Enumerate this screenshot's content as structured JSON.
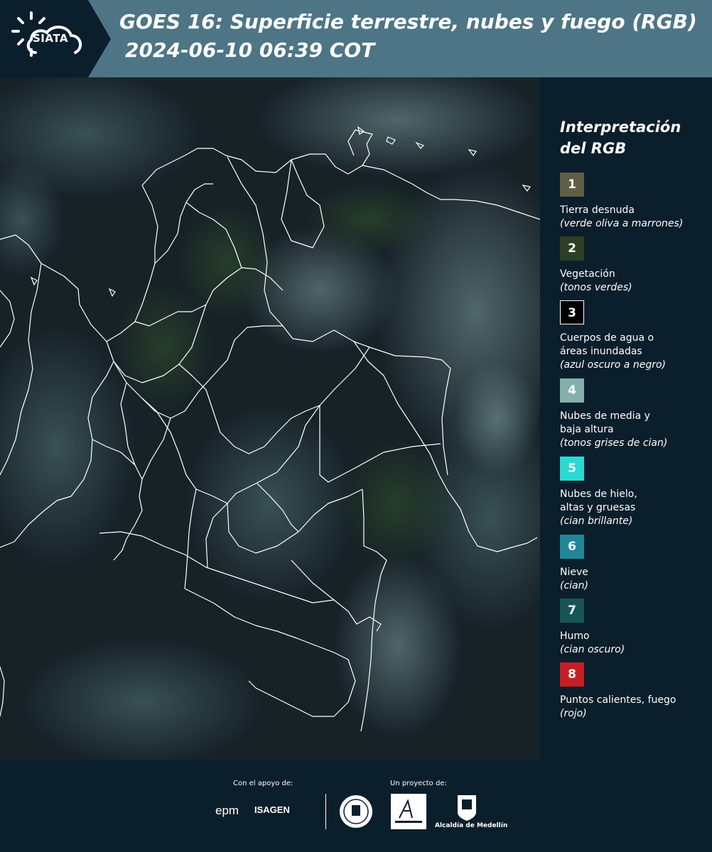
{
  "header": {
    "logo_text": "SIATA",
    "title_line1": "GOES 16: Superficie terrestre, nubes y fuego (RGB)",
    "title_line2": "2024-06-10 06:39 COT"
  },
  "legend": {
    "title_line1": "Interpretación",
    "title_line2": "del RGB",
    "items": [
      {
        "number": "1",
        "color": "#5f5e46",
        "label_lines": [
          "Tierra desnuda"
        ],
        "sub": "(verde oliva a marrones)"
      },
      {
        "number": "2",
        "color": "#2d4024",
        "label_lines": [
          "Vegetación"
        ],
        "sub": "(tonos verdes)"
      },
      {
        "number": "3",
        "color": "#000000",
        "label_lines": [
          "Cuerpos de agua o",
          "áreas inundadas"
        ],
        "sub": "(azul oscuro a negro)"
      },
      {
        "number": "4",
        "color": "#86aeab",
        "label_lines": [
          "Nubes de media y",
          "baja altura"
        ],
        "sub": "(tonos grises de cian)"
      },
      {
        "number": "5",
        "color": "#2ad9d4",
        "label_lines": [
          "Nubes de hielo,",
          "altas y gruesas"
        ],
        "sub": "(cian brillante)"
      },
      {
        "number": "6",
        "color": "#1f8799",
        "label_lines": [
          "Nieve"
        ],
        "sub": "(cian)"
      },
      {
        "number": "7",
        "color": "#185557",
        "label_lines": [
          "Humo"
        ],
        "sub": "(cian oscuro)"
      },
      {
        "number": "8",
        "color": "#c51f24",
        "label_lines": [
          "Puntos calientes, fuego"
        ],
        "sub": "(rojo)"
      }
    ]
  },
  "footer": {
    "support_caption": "Con el apoyo de:",
    "project_caption": "Un proyecto de:",
    "epm_logo": "epm",
    "isagen_logo": "ISAGEN",
    "medellin_logo": "Alcaldía de Medellín"
  },
  "colors": {
    "header_band": "#4d7585",
    "header_dark": "#0b1e2b",
    "panel_bg": "#0b1e2b",
    "map_base": "#1a2328",
    "border_lines": "#ffffff"
  }
}
